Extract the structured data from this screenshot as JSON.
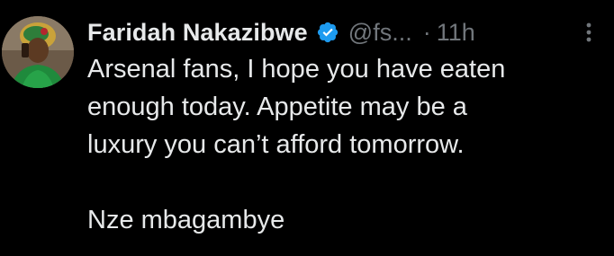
{
  "tweet": {
    "author": {
      "display_name": "Faridah Nakazibwe",
      "handle": "@fs...",
      "verified": true,
      "avatar_icon": "profile-photo"
    },
    "separator": "·",
    "timestamp": "11h",
    "more_icon": "more-vertical-icon",
    "text_lines": [
      "Arsenal fans, I hope you have eaten",
      "enough today. Appetite may be a",
      "luxury you can’t afford tomorrow."
    ],
    "text_line_after_gap": "Nze mbagambye",
    "colors": {
      "background": "#000000",
      "text_primary": "#e7e9ea",
      "text_secondary": "#71767b",
      "verified_badge": "#1d9bf0"
    }
  }
}
